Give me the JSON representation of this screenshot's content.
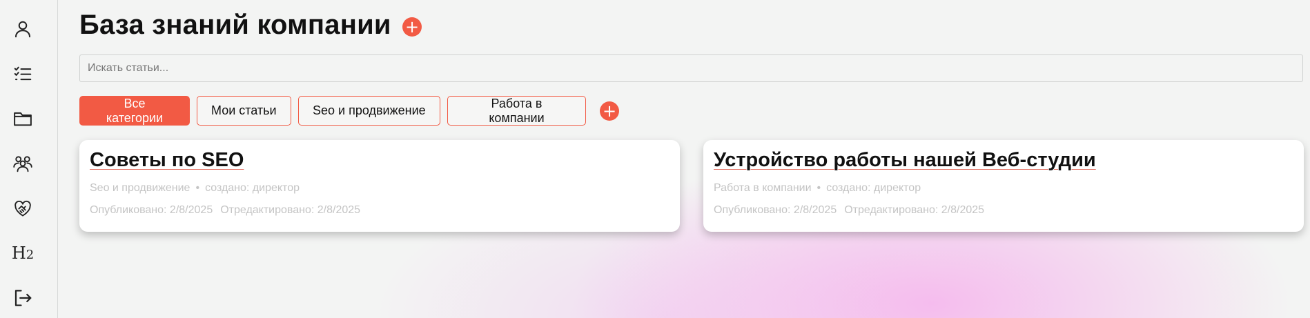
{
  "sidebar": {
    "items": [
      {
        "icon": "user-icon"
      },
      {
        "icon": "checklist-icon"
      },
      {
        "icon": "folder-icon"
      },
      {
        "icon": "team-icon"
      },
      {
        "icon": "handshake-icon"
      },
      {
        "icon": "heading-h2-icon",
        "glyph": "H",
        "sub": "2"
      },
      {
        "icon": "logout-icon"
      }
    ]
  },
  "header": {
    "title": "База знаний компании",
    "add_label": "+"
  },
  "search": {
    "placeholder": "Искать статьи...",
    "value": ""
  },
  "categories": {
    "items": [
      {
        "label": "Все категории",
        "active": true
      },
      {
        "label": "Мои статьи",
        "active": false
      },
      {
        "label": "Seo и продвижение",
        "active": false
      },
      {
        "label": "Работа в компании",
        "active": false
      }
    ],
    "add_label": "+"
  },
  "articles": [
    {
      "title": "Советы по SEO",
      "category": "Seo и продвижение",
      "separator": "•",
      "author": "создано: директор",
      "published": "Опубликовано: 2/8/2025",
      "edited": "Отредактировано: 2/8/2025"
    },
    {
      "title": "Устройство работы нашей Веб-студии",
      "category": "Работа в компании",
      "separator": "•",
      "author": "создано: директор",
      "published": "Опубликовано: 2/8/2025",
      "edited": "Отредактировано: 2/8/2025"
    }
  ],
  "colors": {
    "accent": "#f25a44",
    "background": "#f3f4f3",
    "muted_text": "#c4c4c4"
  }
}
